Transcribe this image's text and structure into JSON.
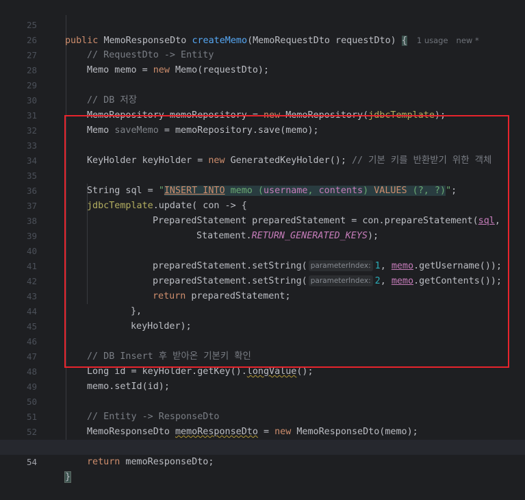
{
  "editor": {
    "lines": [
      {
        "n": "25"
      },
      {
        "n": "26"
      },
      {
        "n": "27"
      },
      {
        "n": "28"
      },
      {
        "n": "29"
      },
      {
        "n": "30"
      },
      {
        "n": "31"
      },
      {
        "n": "32"
      },
      {
        "n": "33"
      },
      {
        "n": "34"
      },
      {
        "n": "35"
      },
      {
        "n": "36"
      },
      {
        "n": "37"
      },
      {
        "n": "38"
      },
      {
        "n": "39"
      },
      {
        "n": "40"
      },
      {
        "n": "41"
      },
      {
        "n": "42"
      },
      {
        "n": "43"
      },
      {
        "n": "44"
      },
      {
        "n": "45"
      },
      {
        "n": "46"
      },
      {
        "n": "47"
      },
      {
        "n": "48"
      },
      {
        "n": "49"
      },
      {
        "n": "50"
      },
      {
        "n": "51"
      },
      {
        "n": "52"
      },
      {
        "n": "53"
      },
      {
        "n": "54"
      }
    ],
    "t": {
      "l25_public": "public",
      "l25_type": "MemoResponseDto",
      "l25_method": "createMemo",
      "l25_params": "(MemoRequestDto requestDto) ",
      "l25_brace": "{",
      "l25_usage": "1 usage",
      "l25_new": "new *",
      "l26": "// RequestDto -> Entity",
      "l27_a": "Memo memo = ",
      "l27_new": "new",
      "l27_b": " Memo(requestDto);",
      "l29": "// DB 저장",
      "l30_a": "MemoRepository memoRepository = ",
      "l30_new": "new",
      "l30_b": " MemoRepository(",
      "l30_field": "jdbcTemplate",
      "l30_c": ");",
      "l31_a": "Memo ",
      "l31_var": "saveMemo",
      "l31_b": " = memoRepository.save(memo);",
      "l33_a": "KeyHolder keyHolder = ",
      "l33_new": "new",
      "l33_b": " GeneratedKeyHolder(); ",
      "l33_cm": "// 기본 키를 반환받기 위한 객체",
      "l35_a": "String sql = ",
      "l35_q1": "\"",
      "l35_insert": "INSERT INTO",
      "l35_memo": " memo (",
      "l35_username": "username",
      "l35_comma": ", ",
      "l35_contents": "contents",
      "l35_close": ") ",
      "l35_values": "VALUES",
      "l35_vals": " (?, ?)",
      "l35_q2": "\"",
      "l35_end": ";",
      "l36_field": "jdbcTemplate",
      "l36_b": ".update( con -> {",
      "l37_a": "PreparedStatement preparedStatement = con.prepareStatement(",
      "l37_sql": "sql",
      "l37_b": ",",
      "l38_a": "Statement.",
      "l38_const": "RETURN_GENERATED_KEYS",
      "l38_b": ");",
      "l40_a": "preparedStatement.setString(",
      "l40_hint": "parameterIndex:",
      "l40_num": "1",
      "l40_b": ", ",
      "l40_memo": "memo",
      "l40_c": ".getUsername());",
      "l41_a": "preparedStatement.setString(",
      "l41_hint": "parameterIndex:",
      "l41_num": "2",
      "l41_b": ", ",
      "l41_memo": "memo",
      "l41_c": ".getContents());",
      "l42_ret": "return",
      "l42_b": " preparedStatement;",
      "l43": "},",
      "l44": "keyHolder);",
      "l46": "// DB Insert 후 받아온 기본키 확인",
      "l47_a": "Long id = keyHolder.getKey().",
      "l47_warn": "longValue",
      "l47_b": "();",
      "l48": "memo.setId(id);",
      "l50": "// Entity -> ResponseDto",
      "l51_a": "MemoResponseDto ",
      "l51_var": "memoResponseDto",
      "l51_b": " = ",
      "l51_new": "new",
      "l51_c": " MemoResponseDto(memo);",
      "l53_ret": "return",
      "l53_b": " memoResponseDto;",
      "l54": "}"
    }
  }
}
